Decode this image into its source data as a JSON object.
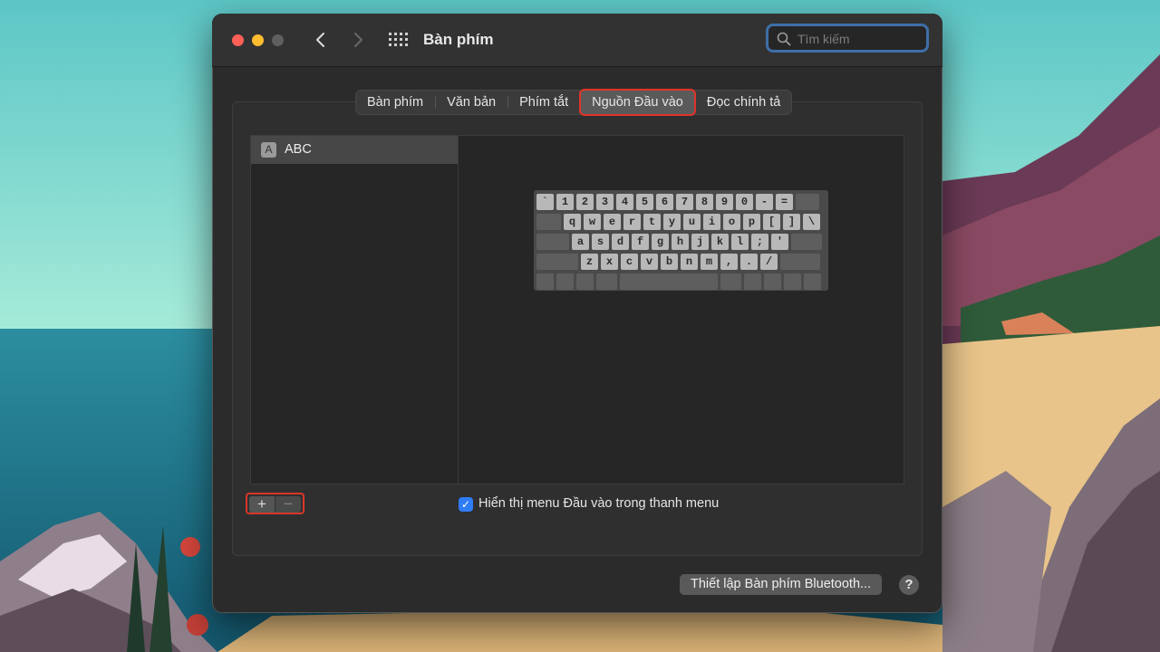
{
  "window": {
    "title": "Bàn phím",
    "search_placeholder": "Tìm kiếm"
  },
  "tabs": [
    {
      "label": "Bàn phím",
      "active": false
    },
    {
      "label": "Văn bản",
      "active": false
    },
    {
      "label": "Phím tắt",
      "active": false
    },
    {
      "label": "Nguồn Đầu vào",
      "active": true
    },
    {
      "label": "Đọc chính tả",
      "active": false
    }
  ],
  "input_sources": [
    {
      "badge": "A",
      "label": "ABC",
      "selected": true
    }
  ],
  "keyboard": {
    "row1": [
      "`",
      "1",
      "2",
      "3",
      "4",
      "5",
      "6",
      "7",
      "8",
      "9",
      "0",
      "-",
      "="
    ],
    "row2": [
      "q",
      "w",
      "e",
      "r",
      "t",
      "y",
      "u",
      "i",
      "o",
      "p",
      "[",
      "]",
      "\\"
    ],
    "row3": [
      "a",
      "s",
      "d",
      "f",
      "g",
      "h",
      "j",
      "k",
      "l",
      ";",
      "'"
    ],
    "row4": [
      "z",
      "x",
      "c",
      "v",
      "b",
      "n",
      "m",
      ",",
      ".",
      "/"
    ]
  },
  "list_controls": {
    "add": "+",
    "remove": "−"
  },
  "show_input_menu": {
    "label": "Hiển thị menu Đầu vào trong thanh menu",
    "checked": true,
    "check_glyph": "✓"
  },
  "bluetooth_button": "Thiết lập Bàn phím Bluetooth...",
  "help_button": "?",
  "colors": {
    "accent": "#2f7cf6",
    "highlight_outline": "#e03428",
    "window_bg": "#2b2b2b"
  }
}
